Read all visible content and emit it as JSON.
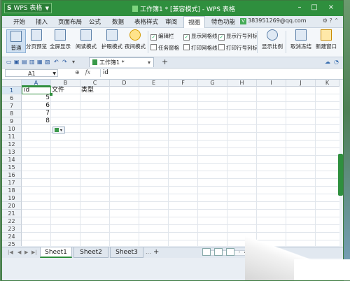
{
  "titlebar": {
    "app_label": "WPS 表格",
    "app_letter": "S",
    "title": "工作簿1 * [兼容模式] - WPS 表格",
    "min_label": "–",
    "max_label": "□",
    "close_label": "×"
  },
  "menu": {
    "items": [
      "开始",
      "插入",
      "页面布局",
      "公式",
      "数据",
      "表格样式",
      "审阅",
      "视图",
      "特色功能"
    ],
    "active": "视图",
    "account": "383951269@qq.com"
  },
  "ribbon": {
    "buttons": [
      {
        "label": "普通",
        "icon": "normal-view-icon"
      },
      {
        "label": "分页预览",
        "icon": "page-break-icon"
      },
      {
        "label": "全屏显示",
        "icon": "fullscreen-icon"
      },
      {
        "label": "阅读模式",
        "icon": "reading-mode-icon"
      },
      {
        "label": "护眼模式",
        "icon": "eye-care-icon"
      },
      {
        "label": "夜间模式",
        "icon": "night-mode-icon"
      }
    ],
    "checks": [
      {
        "label": "编辑栏",
        "checked": true
      },
      {
        "label": "任务窗格",
        "checked": false
      },
      {
        "label": "显示网格线",
        "checked": true
      },
      {
        "label": "打印网格线",
        "checked": false
      },
      {
        "label": "显示行号列标",
        "checked": true
      },
      {
        "label": "打印行号列标",
        "checked": false
      }
    ],
    "right_buttons": [
      {
        "label": "显示比例",
        "icon": "zoom-icon"
      },
      {
        "label": "取消冻结",
        "icon": "unfreeze-icon"
      },
      {
        "label": "新建窗口",
        "icon": "new-window-icon"
      }
    ]
  },
  "doc_tab": {
    "name": "工作簿1 *",
    "plus": "+"
  },
  "formula": {
    "name_box": "A1",
    "fx": "fx",
    "content": "id"
  },
  "grid": {
    "columns": [
      "A",
      "B",
      "C",
      "D",
      "E",
      "F",
      "G",
      "H",
      "I",
      "J",
      "K"
    ],
    "row_numbers": [
      "1",
      "6",
      "7",
      "8",
      "9",
      "10",
      "11",
      "12",
      "13",
      "14",
      "15",
      "16",
      "17",
      "18",
      "19",
      "20",
      "21",
      "22",
      "23",
      "24",
      "25"
    ],
    "header_row": {
      "a": "id",
      "b": "文件",
      "c": "类型"
    },
    "values": [
      "5",
      "6",
      "7",
      "8"
    ]
  },
  "sheets": {
    "tabs": [
      "Sheet1",
      "Sheet2",
      "Sheet3"
    ],
    "active": "Sheet1",
    "more": "..."
  },
  "status": {
    "zoom_label": "-"
  },
  "colors": {
    "accent": "#2f8f3e",
    "selection": "#2f8f3e"
  }
}
